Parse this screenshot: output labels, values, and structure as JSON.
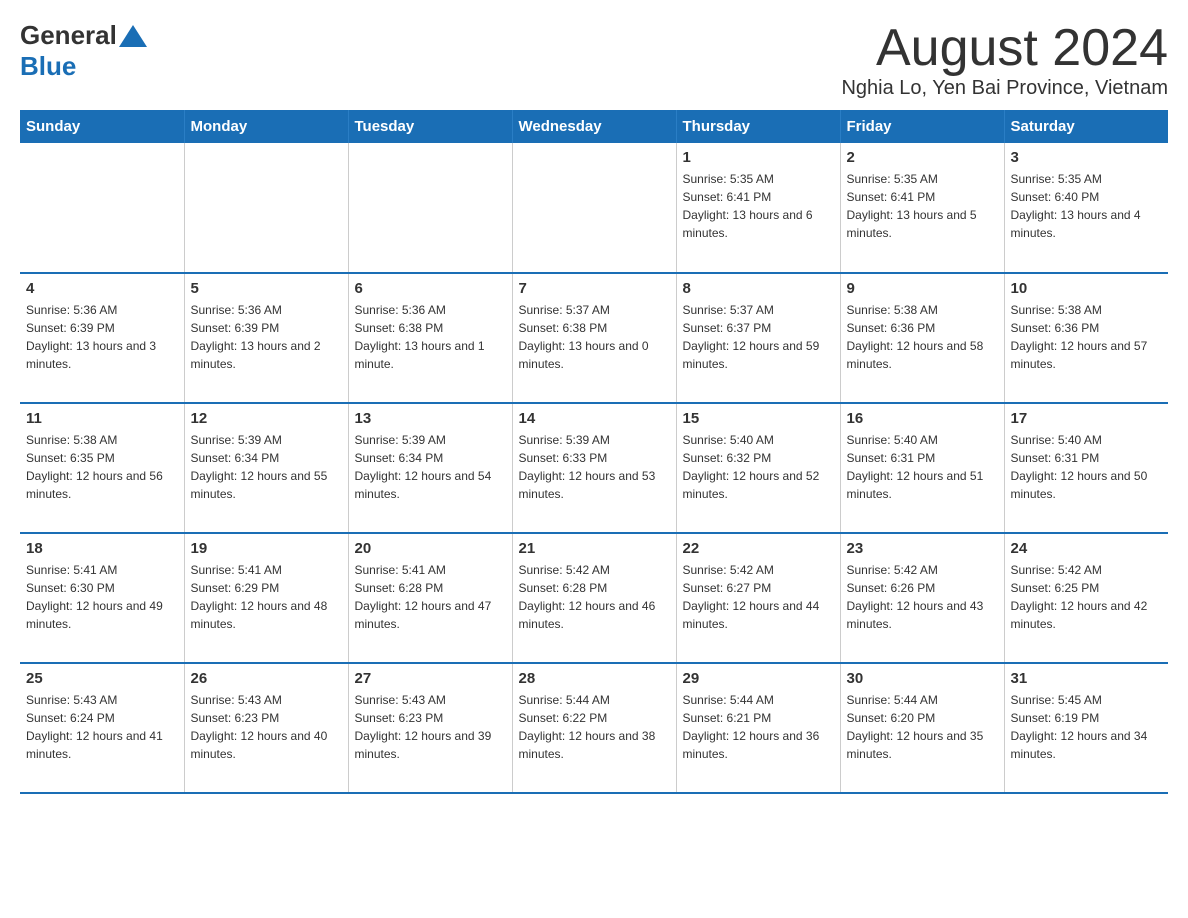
{
  "header": {
    "logo_general": "General",
    "logo_blue": "Blue",
    "month_title": "August 2024",
    "location": "Nghia Lo, Yen Bai Province, Vietnam"
  },
  "days_of_week": [
    "Sunday",
    "Monday",
    "Tuesday",
    "Wednesday",
    "Thursday",
    "Friday",
    "Saturday"
  ],
  "weeks": [
    [
      {
        "day": "",
        "info": ""
      },
      {
        "day": "",
        "info": ""
      },
      {
        "day": "",
        "info": ""
      },
      {
        "day": "",
        "info": ""
      },
      {
        "day": "1",
        "info": "Sunrise: 5:35 AM\nSunset: 6:41 PM\nDaylight: 13 hours and 6 minutes."
      },
      {
        "day": "2",
        "info": "Sunrise: 5:35 AM\nSunset: 6:41 PM\nDaylight: 13 hours and 5 minutes."
      },
      {
        "day": "3",
        "info": "Sunrise: 5:35 AM\nSunset: 6:40 PM\nDaylight: 13 hours and 4 minutes."
      }
    ],
    [
      {
        "day": "4",
        "info": "Sunrise: 5:36 AM\nSunset: 6:39 PM\nDaylight: 13 hours and 3 minutes."
      },
      {
        "day": "5",
        "info": "Sunrise: 5:36 AM\nSunset: 6:39 PM\nDaylight: 13 hours and 2 minutes."
      },
      {
        "day": "6",
        "info": "Sunrise: 5:36 AM\nSunset: 6:38 PM\nDaylight: 13 hours and 1 minute."
      },
      {
        "day": "7",
        "info": "Sunrise: 5:37 AM\nSunset: 6:38 PM\nDaylight: 13 hours and 0 minutes."
      },
      {
        "day": "8",
        "info": "Sunrise: 5:37 AM\nSunset: 6:37 PM\nDaylight: 12 hours and 59 minutes."
      },
      {
        "day": "9",
        "info": "Sunrise: 5:38 AM\nSunset: 6:36 PM\nDaylight: 12 hours and 58 minutes."
      },
      {
        "day": "10",
        "info": "Sunrise: 5:38 AM\nSunset: 6:36 PM\nDaylight: 12 hours and 57 minutes."
      }
    ],
    [
      {
        "day": "11",
        "info": "Sunrise: 5:38 AM\nSunset: 6:35 PM\nDaylight: 12 hours and 56 minutes."
      },
      {
        "day": "12",
        "info": "Sunrise: 5:39 AM\nSunset: 6:34 PM\nDaylight: 12 hours and 55 minutes."
      },
      {
        "day": "13",
        "info": "Sunrise: 5:39 AM\nSunset: 6:34 PM\nDaylight: 12 hours and 54 minutes."
      },
      {
        "day": "14",
        "info": "Sunrise: 5:39 AM\nSunset: 6:33 PM\nDaylight: 12 hours and 53 minutes."
      },
      {
        "day": "15",
        "info": "Sunrise: 5:40 AM\nSunset: 6:32 PM\nDaylight: 12 hours and 52 minutes."
      },
      {
        "day": "16",
        "info": "Sunrise: 5:40 AM\nSunset: 6:31 PM\nDaylight: 12 hours and 51 minutes."
      },
      {
        "day": "17",
        "info": "Sunrise: 5:40 AM\nSunset: 6:31 PM\nDaylight: 12 hours and 50 minutes."
      }
    ],
    [
      {
        "day": "18",
        "info": "Sunrise: 5:41 AM\nSunset: 6:30 PM\nDaylight: 12 hours and 49 minutes."
      },
      {
        "day": "19",
        "info": "Sunrise: 5:41 AM\nSunset: 6:29 PM\nDaylight: 12 hours and 48 minutes."
      },
      {
        "day": "20",
        "info": "Sunrise: 5:41 AM\nSunset: 6:28 PM\nDaylight: 12 hours and 47 minutes."
      },
      {
        "day": "21",
        "info": "Sunrise: 5:42 AM\nSunset: 6:28 PM\nDaylight: 12 hours and 46 minutes."
      },
      {
        "day": "22",
        "info": "Sunrise: 5:42 AM\nSunset: 6:27 PM\nDaylight: 12 hours and 44 minutes."
      },
      {
        "day": "23",
        "info": "Sunrise: 5:42 AM\nSunset: 6:26 PM\nDaylight: 12 hours and 43 minutes."
      },
      {
        "day": "24",
        "info": "Sunrise: 5:42 AM\nSunset: 6:25 PM\nDaylight: 12 hours and 42 minutes."
      }
    ],
    [
      {
        "day": "25",
        "info": "Sunrise: 5:43 AM\nSunset: 6:24 PM\nDaylight: 12 hours and 41 minutes."
      },
      {
        "day": "26",
        "info": "Sunrise: 5:43 AM\nSunset: 6:23 PM\nDaylight: 12 hours and 40 minutes."
      },
      {
        "day": "27",
        "info": "Sunrise: 5:43 AM\nSunset: 6:23 PM\nDaylight: 12 hours and 39 minutes."
      },
      {
        "day": "28",
        "info": "Sunrise: 5:44 AM\nSunset: 6:22 PM\nDaylight: 12 hours and 38 minutes."
      },
      {
        "day": "29",
        "info": "Sunrise: 5:44 AM\nSunset: 6:21 PM\nDaylight: 12 hours and 36 minutes."
      },
      {
        "day": "30",
        "info": "Sunrise: 5:44 AM\nSunset: 6:20 PM\nDaylight: 12 hours and 35 minutes."
      },
      {
        "day": "31",
        "info": "Sunrise: 5:45 AM\nSunset: 6:19 PM\nDaylight: 12 hours and 34 minutes."
      }
    ]
  ]
}
